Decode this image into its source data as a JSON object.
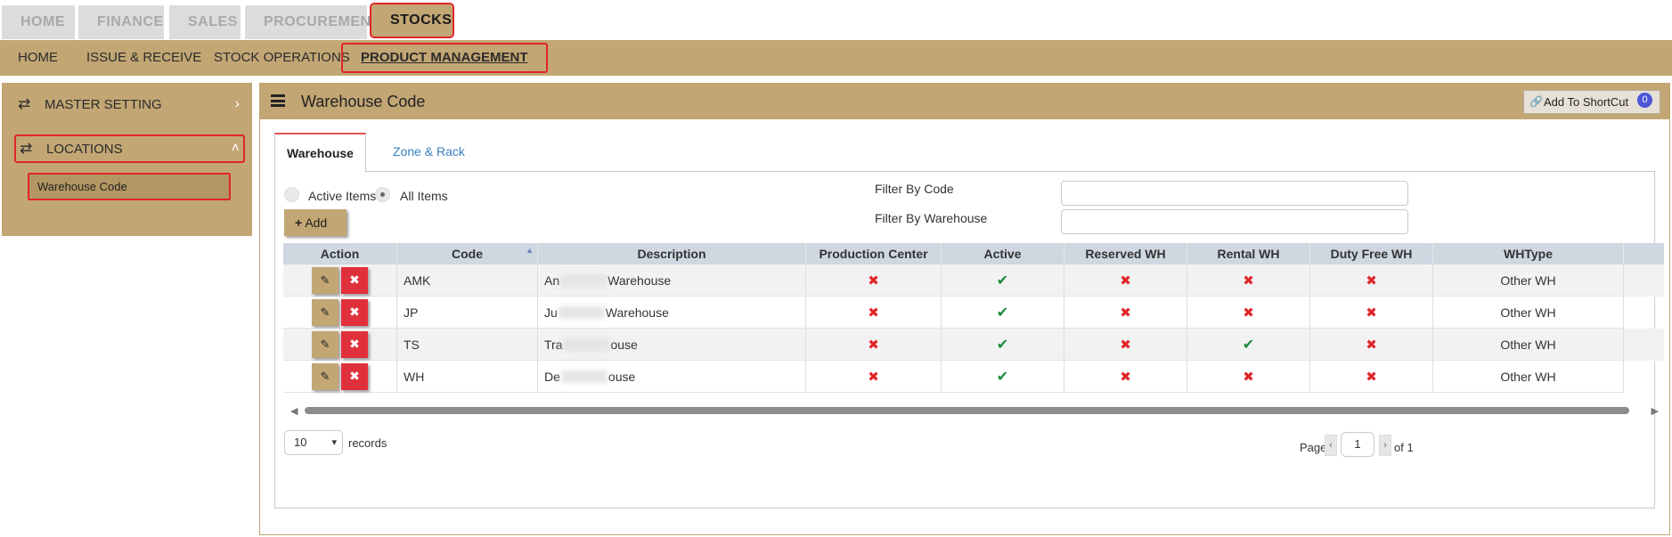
{
  "top_tabs": [
    {
      "label": "HOME",
      "icon": "home-icon"
    },
    {
      "label": "FINANCE",
      "icon": "bank-icon"
    },
    {
      "label": "SALES",
      "icon": "cart-icon"
    },
    {
      "label": "PROCUREMENT",
      "icon": "megaphone-icon"
    },
    {
      "label": "STOCKS",
      "icon": "factory-icon"
    }
  ],
  "subnav": [
    "HOME",
    "ISSUE & RECEIVE",
    "STOCK OPERATIONS",
    "PRODUCT MANAGEMENT"
  ],
  "sidebar": {
    "items": [
      {
        "label": "MASTER SETTING",
        "chevron": ">"
      },
      {
        "label": "LOCATIONS",
        "chevron": "^"
      }
    ],
    "sub_item": "Warehouse Code"
  },
  "panel": {
    "title": "Warehouse Code",
    "shortcut_label": "Add To ShortCut",
    "shortcut_count": "0",
    "tabs": [
      "Warehouse",
      "Zone & Rack"
    ]
  },
  "filters": {
    "radio_active": "Active Items",
    "radio_all": "All Items",
    "add_label": "Add",
    "filter_code_label": "Filter By Code",
    "filter_wh_label": "Filter By Warehouse"
  },
  "table": {
    "headers": [
      "Action",
      "Code",
      "Description",
      "Production Center",
      "Active",
      "Reserved WH",
      "Rental WH",
      "Duty Free WH",
      "WHType"
    ],
    "rows": [
      {
        "code": "AMK",
        "desc_prefix": "An",
        "desc_suffix": "Warehouse",
        "production": false,
        "active": true,
        "reserved": false,
        "rental": false,
        "duty_free": false,
        "whtype": "Other WH"
      },
      {
        "code": "JP",
        "desc_prefix": "Ju",
        "desc_suffix": "Warehouse",
        "production": false,
        "active": true,
        "reserved": false,
        "rental": false,
        "duty_free": false,
        "whtype": "Other WH"
      },
      {
        "code": "TS",
        "desc_prefix": "Tra",
        "desc_suffix": "ouse",
        "production": false,
        "active": true,
        "reserved": false,
        "rental": true,
        "duty_free": false,
        "whtype": "Other WH"
      },
      {
        "code": "WH",
        "desc_prefix": "De",
        "desc_suffix": "ouse",
        "production": false,
        "active": true,
        "reserved": false,
        "rental": false,
        "duty_free": false,
        "whtype": "Other WH"
      }
    ]
  },
  "pager": {
    "page_size": "10",
    "records_label": "records",
    "page_label": "Page",
    "page_value": "1",
    "of_label": "of 1"
  },
  "colors": {
    "accent": "#c2a674",
    "highlight": "#e0262a",
    "grid_header": "#cfd7e1",
    "badge": "#4b55d6"
  }
}
